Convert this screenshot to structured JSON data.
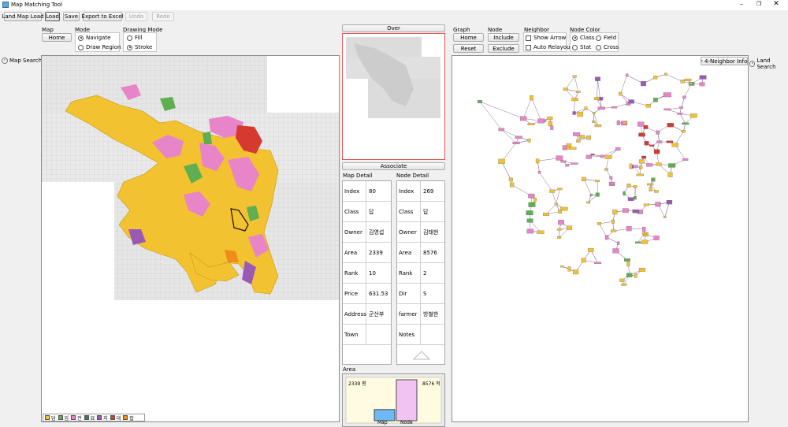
{
  "window": {
    "title": "Map Matching Tool"
  },
  "toolbar": [
    {
      "id": "land-map-load",
      "label": "Land Map Load",
      "enabled": true
    },
    {
      "id": "load",
      "label": "Load",
      "enabled": true
    },
    {
      "id": "save",
      "label": "Save",
      "enabled": true
    },
    {
      "id": "export-excel",
      "label": "Export to Excel",
      "enabled": true
    },
    {
      "id": "undo",
      "label": "Undo",
      "enabled": false
    },
    {
      "id": "redo",
      "label": "Redo",
      "enabled": false
    }
  ],
  "left": {
    "map_label": "Map",
    "home_label": "Home",
    "mode_label": "Mode",
    "mode_options": [
      "Navigate",
      "Draw Region"
    ],
    "mode_selected": 0,
    "drawing_label": "Drawing Mode",
    "drawing_options": [
      "Fill",
      "Stroke"
    ],
    "drawing_selected": 1,
    "side_tab": "Map Search"
  },
  "legend": [
    {
      "label": "답",
      "color": "#f2c230"
    },
    {
      "label": "임",
      "color": "#5fae52"
    },
    {
      "label": "전",
      "color": "#e884c8"
    },
    {
      "label": "묘",
      "color": "#2e7d5b"
    },
    {
      "label": "지",
      "color": "#9b59b6"
    },
    {
      "label": "대",
      "color": "#d63a2f"
    },
    {
      "label": "잡",
      "color": "#f08c1a"
    }
  ],
  "center": {
    "over_label": "Over",
    "associate_label": "Associate",
    "map_detail_title": "Map Detail",
    "node_detail_title": "Node Detail",
    "map_detail": [
      {
        "key": "Index",
        "value": "80"
      },
      {
        "key": "Class",
        "value": "답"
      },
      {
        "key": "Owner",
        "value": "김영섭"
      },
      {
        "key": "Area",
        "value": "2339"
      },
      {
        "key": "Rank",
        "value": "10"
      },
      {
        "key": "Price",
        "value": "631.53"
      },
      {
        "key": "Address",
        "value": "군산부"
      },
      {
        "key": "Town",
        "value": ""
      }
    ],
    "node_detail": [
      {
        "key": "Index",
        "value": "269"
      },
      {
        "key": "Class",
        "value": "답"
      },
      {
        "key": "Owner",
        "value": "김태현"
      },
      {
        "key": "Area",
        "value": "8576"
      },
      {
        "key": "Rank",
        "value": "2"
      },
      {
        "key": "Dir",
        "value": "S"
      },
      {
        "key": "farmer",
        "value": "방철한"
      },
      {
        "key": "Notes",
        "value": ""
      }
    ],
    "area_title": "Area",
    "area_left_text": "2339 평",
    "area_right_text": "8576 적",
    "chart_data": {
      "type": "bar",
      "categories": [
        "Map",
        "Node"
      ],
      "values": [
        2339,
        8576
      ],
      "colors": [
        "#6db8f5",
        "#f1c3f2"
      ]
    }
  },
  "right": {
    "graph_label": "Graph",
    "home_label": "Home",
    "reset_label": "Reset",
    "node_label": "Node",
    "include_label": "Include",
    "exclude_label": "Exclude",
    "neighbor_label": "Neighbor",
    "show_arrow_label": "Show Arrow",
    "auto_relayout_label": "Auto Relayout",
    "node_color_label": "Node Color",
    "node_color_options": [
      "Class",
      "Field",
      "Stat",
      "Cross"
    ],
    "node_color_selected": 0,
    "four_neighbor_label": "4-Neighbor Info",
    "side_tab": "Land Search"
  }
}
